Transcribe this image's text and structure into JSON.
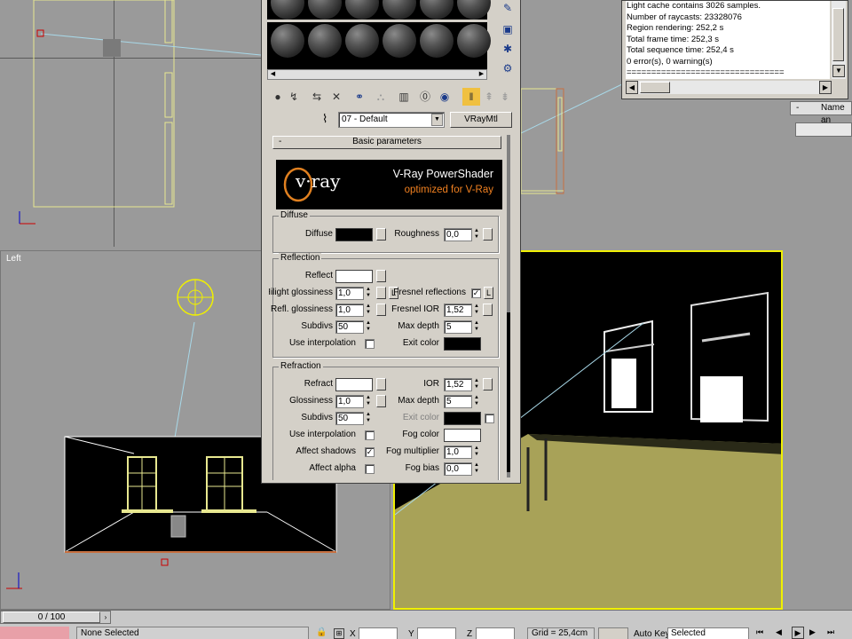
{
  "viewports": {
    "left_label": "Left"
  },
  "material_editor": {
    "material_name": "07 - Default",
    "material_type": "VRayMtl",
    "rollout_title": "Basic parameters",
    "banner": {
      "logo": "v·ray",
      "title": "V-Ray PowerShader",
      "subtitle": "optimized for V-Ray"
    },
    "diffuse": {
      "group": "Diffuse",
      "diffuse_label": "Diffuse",
      "diffuse_color": "#000000",
      "roughness_label": "Roughness",
      "roughness_value": "0,0"
    },
    "reflection": {
      "group": "Reflection",
      "reflect_label": "Reflect",
      "reflect_color": "#ffffff",
      "hilight_label": "Hilight glossiness",
      "hilight_value": "1,0",
      "refl_gloss_label": "Refl. glossiness",
      "refl_gloss_value": "1,0",
      "subdivs_label": "Subdivs",
      "subdivs_value": "50",
      "use_interp_label": "Use interpolation",
      "fresnel_label": "Fresnel reflections",
      "fresnel_ior_label": "Fresnel IOR",
      "fresnel_ior_value": "1,52",
      "max_depth_label": "Max depth",
      "max_depth_value": "5",
      "exit_color_label": "Exit color",
      "exit_color": "#000000",
      "l_label": "L"
    },
    "refraction": {
      "group": "Refraction",
      "refract_label": "Refract",
      "refract_color": "#ffffff",
      "ior_label": "IOR",
      "ior_value": "1,52",
      "gloss_label": "Glossiness",
      "gloss_value": "1,0",
      "max_depth_label": "Max depth",
      "max_depth_value": "5",
      "subdivs_label": "Subdivs",
      "subdivs_value": "50",
      "exit_color_label": "Exit color",
      "use_interp_label": "Use interpolation",
      "fog_color_label": "Fog color",
      "fog_color": "#ffffff",
      "affect_shadows_label": "Affect shadows",
      "fog_mult_label": "Fog multiplier",
      "fog_mult_value": "1,0",
      "affect_alpha_label": "Affect alpha",
      "fog_bias_label": "Fog bias",
      "fog_bias_value": "0,0"
    }
  },
  "log": {
    "lines": [
      "Light cache contains 3026 samples.",
      "Number of raycasts: 23328076",
      "Region rendering: 252,2 s",
      "Total frame time: 252,3 s",
      "Total sequence time: 252,4 s",
      "0 error(s), 0 warning(s)",
      "================================"
    ]
  },
  "command_panel": {
    "rollout_minus": "-",
    "rollout_label": "Name an"
  },
  "bottom": {
    "time_slider": "0 / 100",
    "status": "None Selected",
    "x_label": "X",
    "y_label": "Y",
    "z_label": "Z",
    "grid": "Grid = 25,4cm",
    "auto_key": "Auto Key",
    "key_mode": "Selected"
  }
}
